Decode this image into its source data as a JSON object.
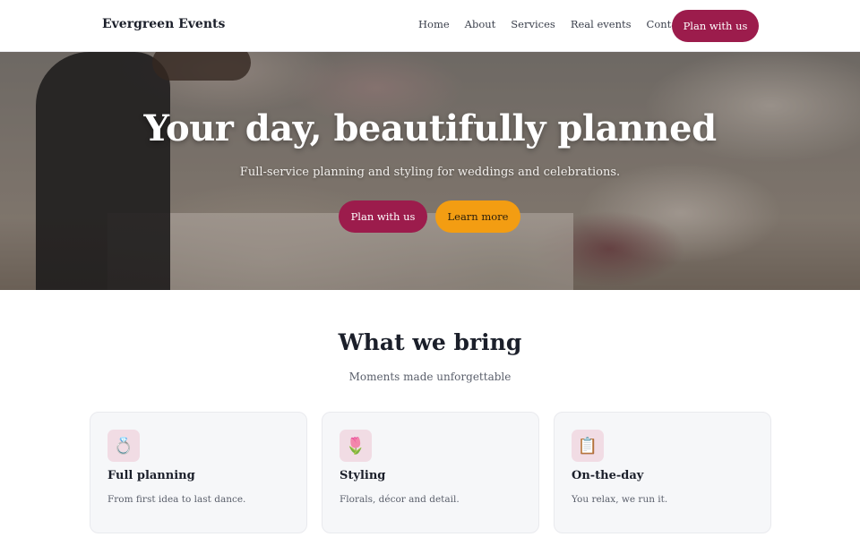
{
  "header": {
    "brand": "Evergreen Events",
    "nav": [
      "Home",
      "About",
      "Services",
      "Real events",
      "Contact"
    ],
    "cta": "Plan with us"
  },
  "hero": {
    "title": "Your day, beautifully planned",
    "subtitle": "Full-service planning and styling for weddings and celebrations.",
    "primary_button": "Plan with us",
    "secondary_button": "Learn more"
  },
  "section": {
    "title": "What we bring",
    "subtitle": "Moments made unforgettable",
    "cards": [
      {
        "icon": "ring-icon",
        "glyph": "💍",
        "title": "Full planning",
        "desc": "From first idea to last dance."
      },
      {
        "icon": "tulip-icon",
        "glyph": "🌷",
        "title": "Styling",
        "desc": "Florals, décor and detail."
      },
      {
        "icon": "clipboard-icon",
        "glyph": "📋",
        "title": "On-the-day",
        "desc": "You relax, we run it."
      }
    ]
  },
  "colors": {
    "brand": "#9c1c4c",
    "accent": "#f39d12",
    "text": "#1b1f2a"
  }
}
